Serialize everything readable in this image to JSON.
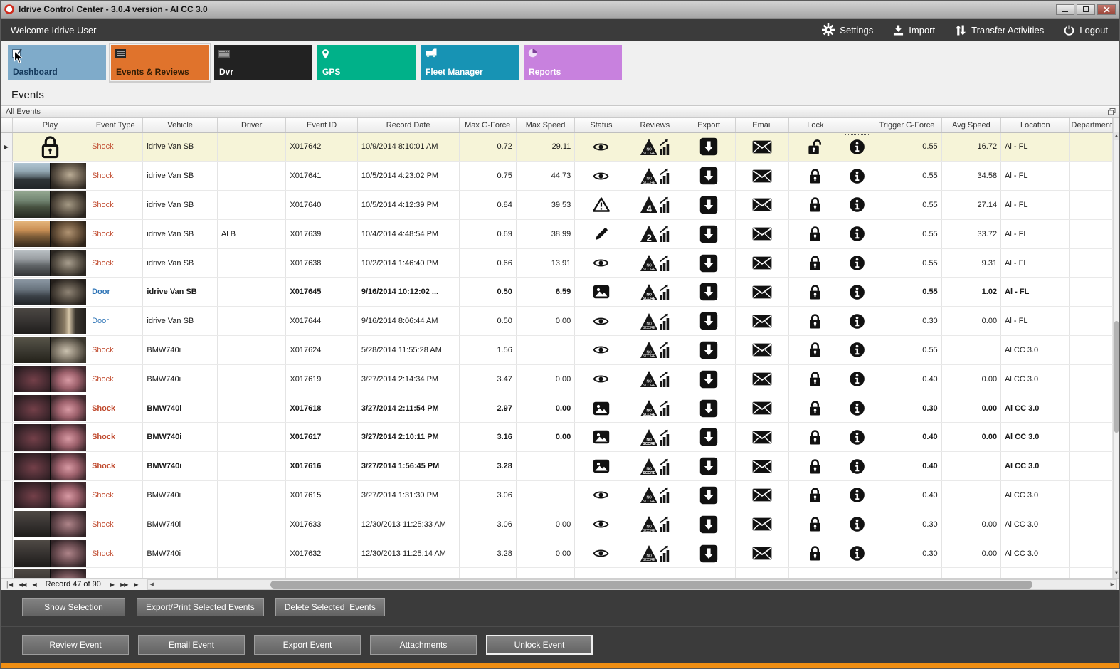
{
  "window": {
    "title": "Idrive Control Center - 3.0.4 version - Al CC 3.0"
  },
  "topbar": {
    "welcome": "Welcome Idrive User",
    "actions": [
      {
        "label": "Settings",
        "icon": "gear-icon"
      },
      {
        "label": "Import",
        "icon": "import-icon"
      },
      {
        "label": "Transfer Activities",
        "icon": "transfer-icon"
      },
      {
        "label": "Logout",
        "icon": "power-icon"
      }
    ]
  },
  "tiles": [
    {
      "label": "Dashboard",
      "icon": "checkbox-icon",
      "color": "#7fabca",
      "text_color": "#14395c",
      "selected": false
    },
    {
      "label": "Events & Reviews",
      "icon": "list-icon",
      "color": "#e0732c",
      "text_color": "#301c05",
      "selected": true
    },
    {
      "label": "Dvr",
      "icon": "film-icon",
      "color": "#222222",
      "text_color": "#ffffff",
      "selected": false
    },
    {
      "label": "GPS",
      "icon": "location-pin-icon",
      "color": "#00b189",
      "text_color": "#ffffff",
      "selected": false
    },
    {
      "label": "Fleet Manager",
      "icon": "van-icon",
      "color": "#1793b4",
      "text_color": "#ffffff",
      "selected": false
    },
    {
      "label": "Reports",
      "icon": "pie-icon",
      "color": "#c881de",
      "text_color": "#ffffff",
      "selected": false
    }
  ],
  "page": {
    "title": "Events",
    "panel_title": "All Events"
  },
  "table": {
    "columns": [
      "",
      "Play",
      "Event Type",
      "Vehicle",
      "Driver",
      "Event ID",
      "Record Date",
      "Max G-Force",
      "Max Speed",
      "Status",
      "Reviews",
      "Export",
      "Email",
      "Lock",
      "",
      "Trigger G-Force",
      "Avg Speed",
      "Location",
      "Department"
    ],
    "rows": [
      {
        "selected": true,
        "locked": true,
        "thumb": "",
        "event_type": "Shock",
        "vehicle": "idrive Van SB",
        "driver": "",
        "event_id": "X017642",
        "record_date": "10/9/2014 8:10:01 AM",
        "max_g": "0.72",
        "max_speed": "29.11",
        "status": "eye",
        "score": "NO SCORE",
        "trigger_g": "0.55",
        "avg_speed": "16.72",
        "location": "Al - FL"
      },
      {
        "thumb": "v1",
        "event_type": "Shock",
        "vehicle": "idrive Van SB",
        "driver": "",
        "event_id": "X017641",
        "record_date": "10/5/2014 4:23:02 PM",
        "max_g": "0.75",
        "max_speed": "44.73",
        "status": "eye",
        "score": "NO SCORE",
        "trigger_g": "0.55",
        "avg_speed": "34.58",
        "location": "Al - FL"
      },
      {
        "thumb": "v2",
        "event_type": "Shock",
        "vehicle": "idrive Van SB",
        "driver": "",
        "event_id": "X017640",
        "record_date": "10/5/2014 4:12:39 PM",
        "max_g": "0.84",
        "max_speed": "39.53",
        "status": "warning",
        "score": "4",
        "trigger_g": "0.55",
        "avg_speed": "27.14",
        "location": "Al - FL"
      },
      {
        "thumb": "v3",
        "event_type": "Shock",
        "vehicle": "idrive Van SB",
        "driver": "Al B",
        "event_id": "X017639",
        "record_date": "10/4/2014 4:48:54 PM",
        "max_g": "0.69",
        "max_speed": "38.99",
        "status": "pencil",
        "score": "2",
        "trigger_g": "0.55",
        "avg_speed": "33.72",
        "location": "Al - FL"
      },
      {
        "thumb": "v4",
        "event_type": "Shock",
        "vehicle": "idrive Van SB",
        "driver": "",
        "event_id": "X017638",
        "record_date": "10/2/2014 1:46:40 PM",
        "max_g": "0.66",
        "max_speed": "13.91",
        "status": "eye",
        "score": "NO SCORE",
        "trigger_g": "0.55",
        "avg_speed": "9.31",
        "location": "Al - FL"
      },
      {
        "bold": true,
        "thumb": "v5",
        "event_type": "Door",
        "vehicle": "idrive Van SB",
        "driver": "",
        "event_id": "X017645",
        "record_date": "9/16/2014 10:12:02 ...",
        "max_g": "0.50",
        "max_speed": "6.59",
        "status": "image",
        "score": "NO SCORE",
        "trigger_g": "0.55",
        "avg_speed": "1.02",
        "location": "Al - FL"
      },
      {
        "thumb": "v6",
        "event_type": "Door",
        "vehicle": "idrive Van SB",
        "driver": "",
        "event_id": "X017644",
        "record_date": "9/16/2014 8:06:44 AM",
        "max_g": "0.50",
        "max_speed": "0.00",
        "status": "eye",
        "score": "NO SCORE",
        "trigger_g": "0.30",
        "avg_speed": "0.00",
        "location": "Al - FL"
      },
      {
        "thumb": "b1",
        "event_type": "Shock",
        "vehicle": "BMW740i",
        "driver": "",
        "event_id": "X017624",
        "record_date": "5/28/2014 11:55:28 AM",
        "max_g": "1.56",
        "max_speed": "",
        "status": "eye",
        "score": "NO SCORE",
        "trigger_g": "0.55",
        "avg_speed": "",
        "location": "Al CC 3.0"
      },
      {
        "thumb": "b2",
        "event_type": "Shock",
        "vehicle": "BMW740i",
        "driver": "",
        "event_id": "X017619",
        "record_date": "3/27/2014 2:14:34 PM",
        "max_g": "3.47",
        "max_speed": "0.00",
        "status": "eye",
        "score": "NO SCORE",
        "trigger_g": "0.40",
        "avg_speed": "0.00",
        "location": "Al CC 3.0"
      },
      {
        "bold": true,
        "thumb": "b2",
        "event_type": "Shock",
        "vehicle": "BMW740i",
        "driver": "",
        "event_id": "X017618",
        "record_date": "3/27/2014 2:11:54 PM",
        "max_g": "2.97",
        "max_speed": "0.00",
        "status": "image",
        "score": "NO SCORE",
        "trigger_g": "0.30",
        "avg_speed": "0.00",
        "location": "Al CC 3.0"
      },
      {
        "bold": true,
        "thumb": "b2",
        "event_type": "Shock",
        "vehicle": "BMW740i",
        "driver": "",
        "event_id": "X017617",
        "record_date": "3/27/2014 2:10:11 PM",
        "max_g": "3.16",
        "max_speed": "0.00",
        "status": "image",
        "score": "NO SCORE",
        "trigger_g": "0.40",
        "avg_speed": "0.00",
        "location": "Al CC 3.0"
      },
      {
        "bold": true,
        "thumb": "b2",
        "event_type": "Shock",
        "vehicle": "BMW740i",
        "driver": "",
        "event_id": "X017616",
        "record_date": "3/27/2014 1:56:45 PM",
        "max_g": "3.28",
        "max_speed": "",
        "status": "image",
        "score": "NO SCORE",
        "trigger_g": "0.40",
        "avg_speed": "",
        "location": "Al CC 3.0"
      },
      {
        "thumb": "b2",
        "event_type": "Shock",
        "vehicle": "BMW740i",
        "driver": "",
        "event_id": "X017615",
        "record_date": "3/27/2014 1:31:30 PM",
        "max_g": "3.06",
        "max_speed": "",
        "status": "eye",
        "score": "NO SCORE",
        "trigger_g": "0.40",
        "avg_speed": "",
        "location": "Al CC 3.0"
      },
      {
        "thumb": "b3",
        "event_type": "Shock",
        "vehicle": "BMW740i",
        "driver": "",
        "event_id": "X017633",
        "record_date": "12/30/2013 11:25:33 AM",
        "max_g": "3.06",
        "max_speed": "0.00",
        "status": "eye",
        "score": "NO SCORE",
        "trigger_g": "0.30",
        "avg_speed": "0.00",
        "location": "Al CC 3.0"
      },
      {
        "thumb": "b3",
        "event_type": "Shock",
        "vehicle": "BMW740i",
        "driver": "",
        "event_id": "X017632",
        "record_date": "12/30/2013 11:25:14 AM",
        "max_g": "3.28",
        "max_speed": "0.00",
        "status": "eye",
        "score": "NO SCORE",
        "trigger_g": "0.30",
        "avg_speed": "0.00",
        "location": "Al CC 3.0"
      }
    ],
    "partial_row": {
      "thumb": "b3"
    }
  },
  "pager": {
    "record_text": "Record 47 of 90"
  },
  "selection_actions": [
    "Show Selection",
    "Export/Print Selected Events",
    "Delete Selected  Events"
  ],
  "event_actions": [
    "Review Event",
    "Email Event",
    "Export Event",
    "Attachments",
    "Unlock Event"
  ],
  "focused_action": "Unlock Event",
  "accent_colors": {
    "shock": "#c04a2e",
    "door": "#2e74b6",
    "selected_row": "#f6f4d8",
    "bottom_bar": "#ef8e13"
  }
}
